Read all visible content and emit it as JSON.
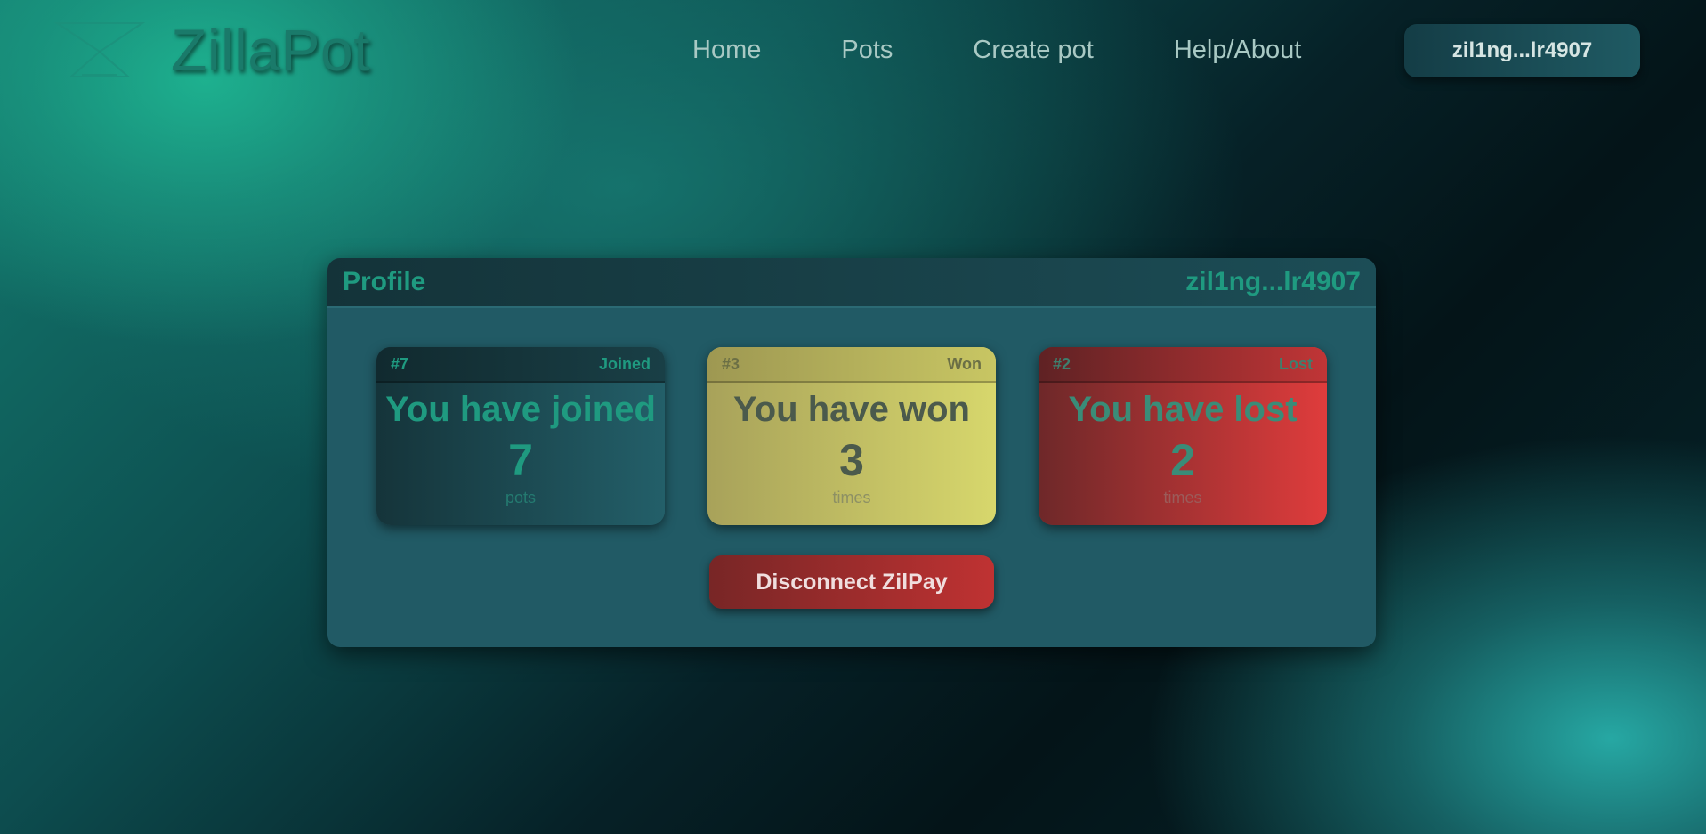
{
  "app": {
    "brand": "ZillaPot"
  },
  "nav": {
    "items": [
      {
        "label": "Home"
      },
      {
        "label": "Pots"
      },
      {
        "label": "Create pot"
      },
      {
        "label": "Help/About"
      }
    ]
  },
  "wallet": {
    "address_short": "zil1ng...lr4907"
  },
  "profile": {
    "title": "Profile",
    "address": "zil1ng...lr4907",
    "cards": {
      "joined": {
        "rank": "#7",
        "tag": "Joined",
        "heading": "You have joined",
        "value": "7",
        "unit": "pots"
      },
      "won": {
        "rank": "#3",
        "tag": "Won",
        "heading": "You have won",
        "value": "3",
        "unit": "times"
      },
      "lost": {
        "rank": "#2",
        "tag": "Lost",
        "heading": "You have lost",
        "value": "2",
        "unit": "times"
      }
    },
    "disconnect_label": "Disconnect ZilPay"
  },
  "colors": {
    "accent": "#1f9a80",
    "won_card": "#d7d76c",
    "lost_card": "#df3c3c",
    "disconnect": "#bf3232"
  },
  "icons": {
    "logo": "hourglass-logo-icon"
  }
}
